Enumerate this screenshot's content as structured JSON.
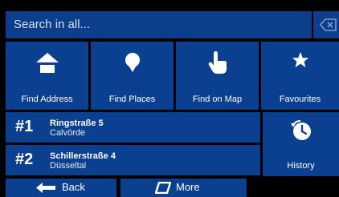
{
  "search": {
    "placeholder": "Search in all..."
  },
  "tiles": [
    {
      "label": "Find Address",
      "icon": "home-icon"
    },
    {
      "label": "Find Places",
      "icon": "map-pin-icon"
    },
    {
      "label": "Find on Map",
      "icon": "tap-hand-icon"
    },
    {
      "label": "Favourites",
      "icon": "star-icon"
    }
  ],
  "recents": [
    {
      "num": "1",
      "title": "Ringstraße 5",
      "subtitle": "Calvörde"
    },
    {
      "num": "2",
      "title": "Schillerstraße 4",
      "subtitle": "Düsseltal"
    }
  ],
  "history": {
    "label": "History",
    "icon": "history-clock-icon"
  },
  "bottom": {
    "back_label": "Back",
    "more_label": "More"
  },
  "colors": {
    "tile": "#0b3f8f",
    "background": "#000000"
  }
}
